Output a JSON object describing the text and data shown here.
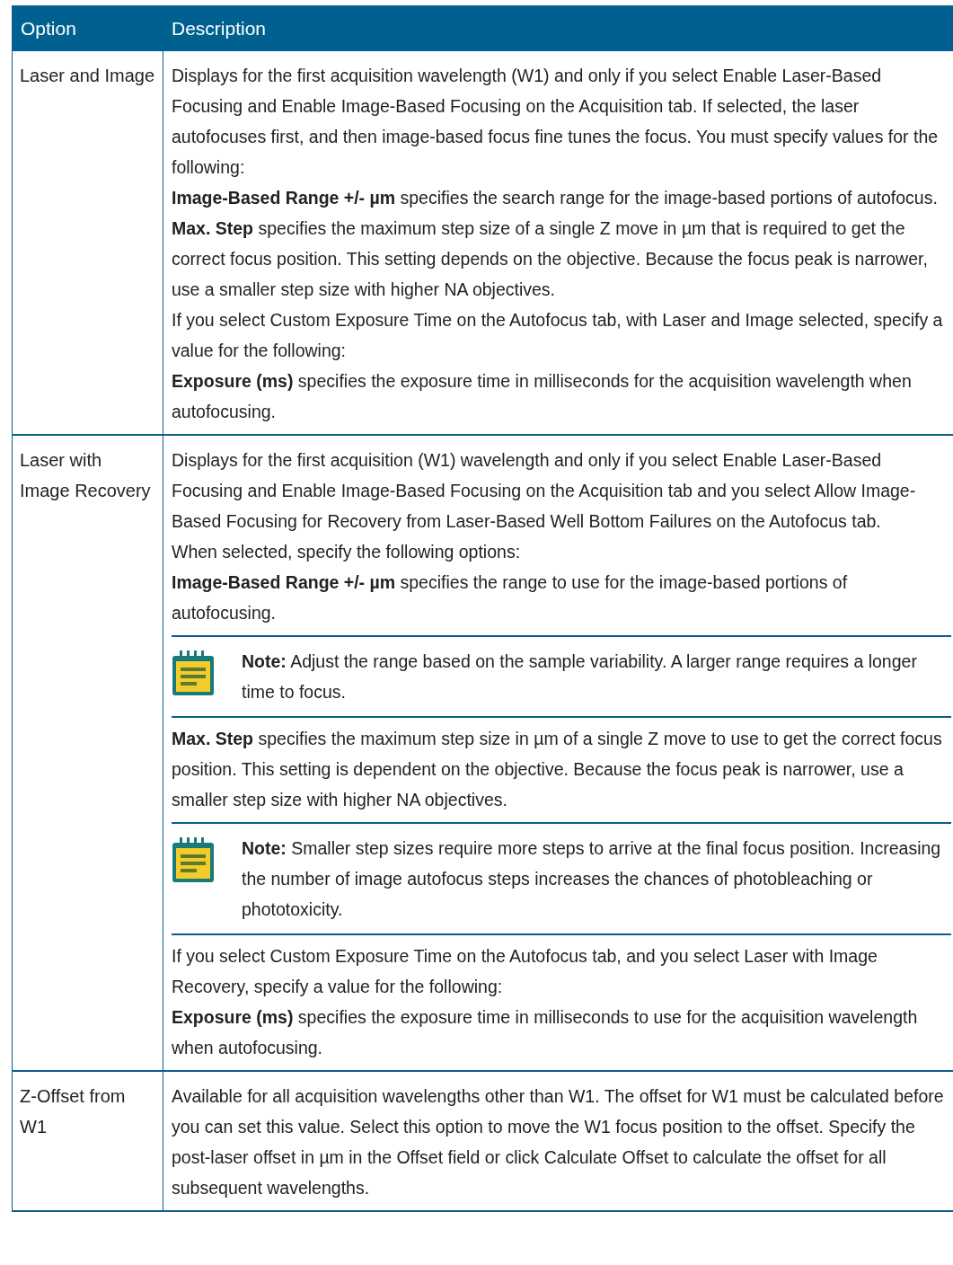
{
  "table": {
    "columns": [
      "Option",
      "Description"
    ],
    "rows": [
      {
        "option": "Laser and Image",
        "blocks": [
          {
            "kind": "para",
            "text": "Displays for the first acquisition wavelength (W1) and only if you select Enable Laser-Based Focusing and Enable Image-Based Focusing on the Acquisition tab. If selected, the laser autofocuses first, and then image-based focus fine tunes the focus. You must specify values for the following:"
          },
          {
            "kind": "para",
            "text": "**Image-Based Range +/- µm** specifies the search range for the image-based portions of autofocus."
          },
          {
            "kind": "para",
            "text": "**Max. Step** specifies the maximum step size of a single Z move in µm that is required to get the correct focus position. This setting depends on the objective. Because the focus peak is narrower, use a smaller step size with higher NA objectives."
          },
          {
            "kind": "para",
            "text": "If you select Custom Exposure Time on the Autofocus tab, with Laser and Image selected, specify a value for the following:"
          },
          {
            "kind": "para",
            "text": "**Exposure (ms)** specifies the exposure time in milliseconds for the acquisition wavelength when autofocusing."
          }
        ]
      },
      {
        "option": "Laser with Image Recovery",
        "blocks": [
          {
            "kind": "para",
            "text": "Displays for the first acquisition (W1) wavelength and only if you select Enable Laser-Based Focusing and Enable Image-Based Focusing on the Acquisition tab and you select Allow Image-Based Focusing for Recovery from Laser-Based Well Bottom Failures on the Autofocus tab."
          },
          {
            "kind": "para",
            "text": "When selected, specify the following options:"
          },
          {
            "kind": "para",
            "text": "**Image-Based Range +/- µm** specifies the range to use for the image-based portions of autofocusing."
          },
          {
            "kind": "note",
            "text": "**Note:** Adjust the range based on the sample variability. A larger range requires a longer time to focus."
          },
          {
            "kind": "para",
            "text": "**Max. Step** specifies the maximum step size in µm of a single Z move to use to get the correct focus position. This setting is dependent on the objective. Because the focus peak is narrower, use a smaller step size with higher NA objectives."
          },
          {
            "kind": "note",
            "text": "**Note:** Smaller step sizes require more steps to arrive at the final focus position. Increasing the number of image autofocus steps increases the chances of photobleaching or phototoxicity."
          },
          {
            "kind": "para",
            "text": "If you select Custom Exposure Time on the Autofocus tab, and you select Laser with Image Recovery, specify a value for the following:"
          },
          {
            "kind": "para",
            "text": "**Exposure (ms)** specifies the exposure time in milliseconds to use for the acquisition wavelength when autofocusing."
          }
        ]
      },
      {
        "option": "Z-Offset from W1",
        "blocks": [
          {
            "kind": "para",
            "text": "Available for all acquisition wavelengths other than W1. The offset for W1 must be calculated before you can set this value. Select this option to move the W1 focus position to the offset. Specify the post-laser offset in µm in the Offset field or click Calculate Offset to calculate the offset for all subsequent wavelengths."
          }
        ]
      }
    ]
  }
}
